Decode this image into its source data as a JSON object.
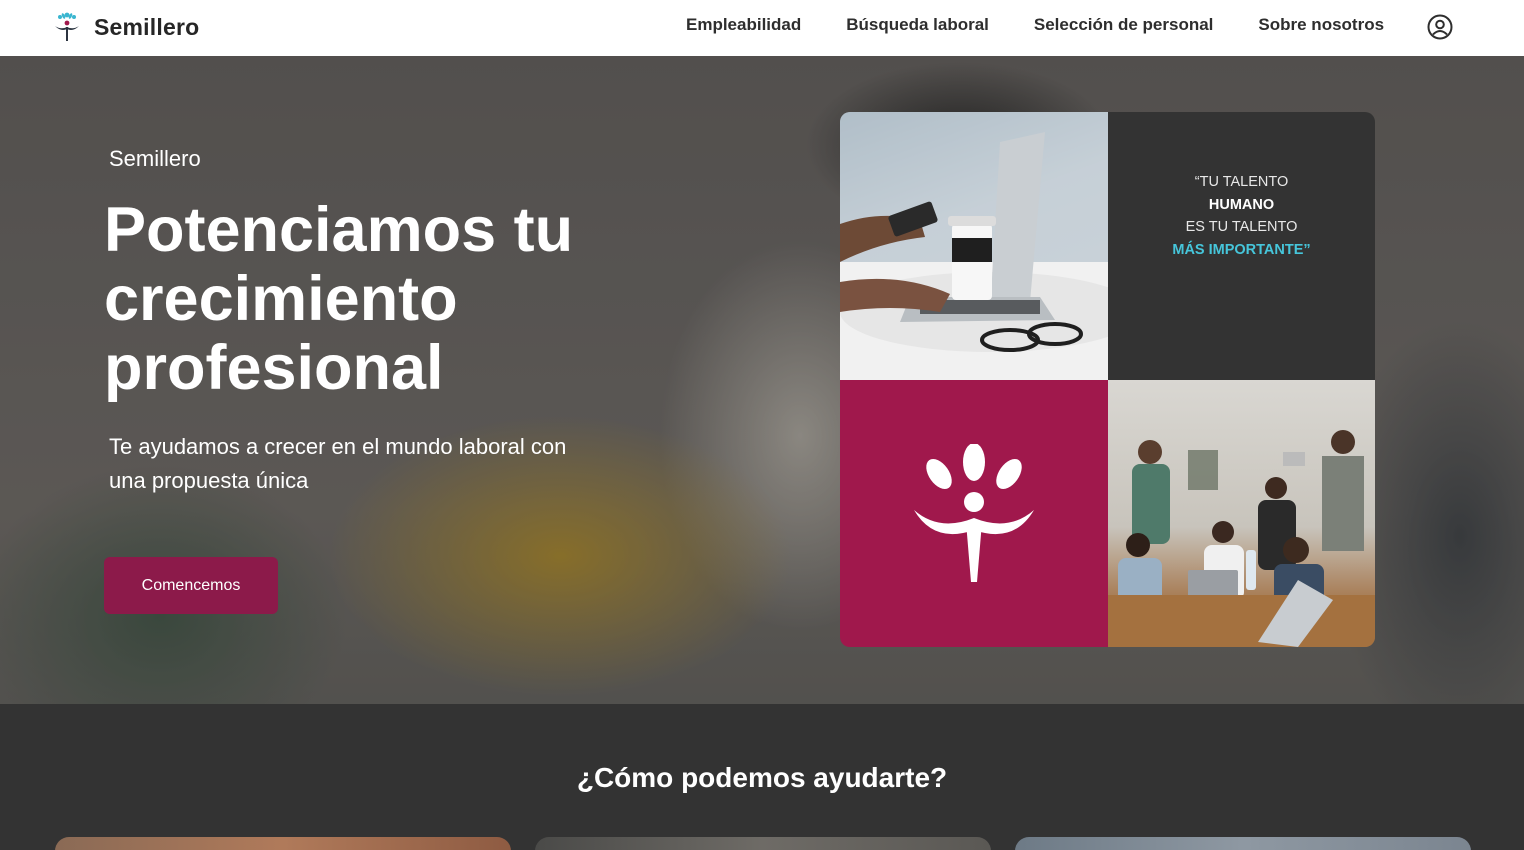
{
  "header": {
    "brand": "Semillero",
    "nav": [
      "Empleabilidad",
      "Búsqueda laboral",
      "Selección de personal",
      "Sobre nosotros"
    ],
    "user_icon": "user-circle-icon"
  },
  "hero": {
    "eyebrow": "Semillero",
    "title": "Potenciamos tu crecimiento profesional",
    "subtitle": "Te ayudamos a crecer en el mundo laboral con una propuesta única",
    "cta": "Comencemos"
  },
  "collage": {
    "quote": {
      "line1": "“TU TALENTO",
      "line2": "HUMANO",
      "line3": "ES TU TALENTO",
      "line4": "MÁS IMPORTANTE”"
    }
  },
  "section": {
    "title": "¿Cómo podemos ayudarte?"
  },
  "colors": {
    "brand": "#8c1a4a",
    "tile_magenta": "#a0184c",
    "dark": "#333333",
    "accent_cyan": "#46c6db"
  }
}
